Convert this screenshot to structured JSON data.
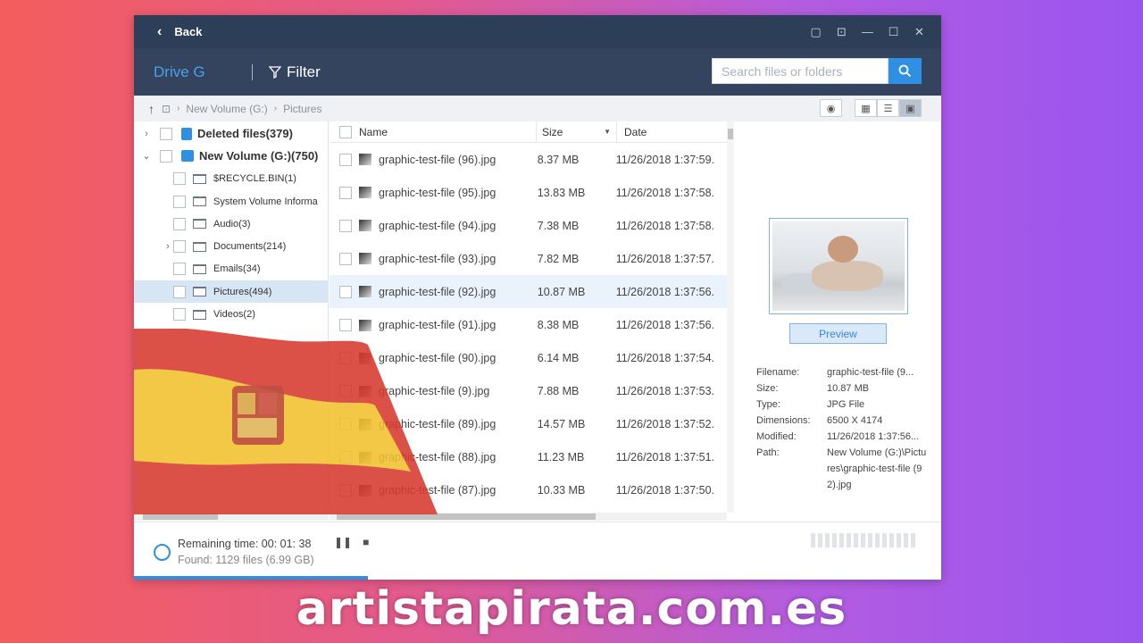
{
  "titlebar": {
    "back_label": "Back"
  },
  "toolbar": {
    "drive_label": "Drive G",
    "filter_label": "Filter",
    "search_placeholder": "Search files or folders"
  },
  "pathbar": {
    "crumbs": [
      "New Volume (G:)",
      "Pictures"
    ]
  },
  "tree": {
    "items": [
      {
        "label": "Deleted files(379)"
      },
      {
        "label": "New Volume (G:)(750)"
      },
      {
        "label": "$RECYCLE.BIN(1)"
      },
      {
        "label": "System Volume Informa"
      },
      {
        "label": "Audio(3)"
      },
      {
        "label": "Documents(214)"
      },
      {
        "label": "Emails(34)"
      },
      {
        "label": "Pictures(494)"
      },
      {
        "label": "Videos(2)"
      }
    ]
  },
  "list": {
    "headers": {
      "name": "Name",
      "size": "Size",
      "date": "Date"
    },
    "rows": [
      {
        "name": "graphic-test-file (96).jpg",
        "size": "8.37 MB",
        "date": "11/26/2018 1:37:59."
      },
      {
        "name": "graphic-test-file (95).jpg",
        "size": "13.83 MB",
        "date": "11/26/2018 1:37:58."
      },
      {
        "name": "graphic-test-file (94).jpg",
        "size": "7.38 MB",
        "date": "11/26/2018 1:37:58."
      },
      {
        "name": "graphic-test-file (93).jpg",
        "size": "7.82 MB",
        "date": "11/26/2018 1:37:57."
      },
      {
        "name": "graphic-test-file (92).jpg",
        "size": "10.87 MB",
        "date": "11/26/2018 1:37:56."
      },
      {
        "name": "graphic-test-file (91).jpg",
        "size": "8.38 MB",
        "date": "11/26/2018 1:37:56."
      },
      {
        "name": "graphic-test-file (90).jpg",
        "size": "6.14 MB",
        "date": "11/26/2018 1:37:54."
      },
      {
        "name": "graphic-test-file (9).jpg",
        "size": "7.88 MB",
        "date": "11/26/2018 1:37:53."
      },
      {
        "name": "graphic-test-file (89).jpg",
        "size": "14.57 MB",
        "date": "11/26/2018 1:37:52."
      },
      {
        "name": "graphic-test-file (88).jpg",
        "size": "11.23 MB",
        "date": "11/26/2018 1:37:51."
      },
      {
        "name": "graphic-test-file (87).jpg",
        "size": "10.33 MB",
        "date": "11/26/2018 1:37:50."
      }
    ]
  },
  "preview": {
    "button_label": "Preview",
    "meta": [
      {
        "key": "Filename:",
        "value": "graphic-test-file (9..."
      },
      {
        "key": "Size:",
        "value": "10.87 MB"
      },
      {
        "key": "Type:",
        "value": "JPG File"
      },
      {
        "key": "Dimensions:",
        "value": "6500 X 4174"
      },
      {
        "key": "Modified:",
        "value": "11/26/2018 1:37:56..."
      },
      {
        "key": "Path:",
        "value": "New Volume (G:)\\Pictures\\graphic-test-file (92).jpg"
      }
    ]
  },
  "status": {
    "remaining": "Remaining time: 00: 01: 38",
    "found": "Found: 1129 files (6.99 GB)",
    "progress_fraction": 0.29
  },
  "banner": {
    "text": "artistapirata.com.es"
  },
  "colors": {
    "accent": "#2f8fe2",
    "titlebar": "#2c3e58",
    "toolbar": "#34445f",
    "selection": "#d6e6f5"
  }
}
